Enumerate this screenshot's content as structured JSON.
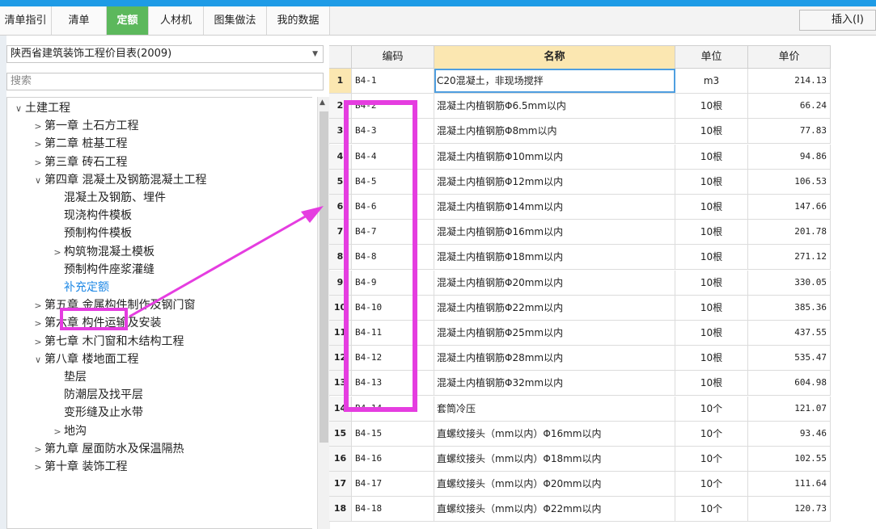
{
  "tabs": [
    {
      "label": "清单指引",
      "active": false
    },
    {
      "label": "清单",
      "active": false
    },
    {
      "label": "定额",
      "active": true
    },
    {
      "label": "人材机",
      "active": false
    },
    {
      "label": "图集做法",
      "active": false
    },
    {
      "label": "我的数据",
      "active": false
    }
  ],
  "insert_label": "插入(I)",
  "library": {
    "selected": "陕西省建筑装饰工程价目表(2009)"
  },
  "search": {
    "placeholder": "搜索"
  },
  "tree": [
    {
      "label": "土建工程",
      "level": 0,
      "toggle": "expanded"
    },
    {
      "label": "第一章 土石方工程",
      "level": 1,
      "toggle": "collapsed"
    },
    {
      "label": "第二章 桩基工程",
      "level": 1,
      "toggle": "collapsed"
    },
    {
      "label": "第三章 砖石工程",
      "level": 1,
      "toggle": "collapsed"
    },
    {
      "label": "第四章 混凝土及钢筋混凝土工程",
      "level": 1,
      "toggle": "expanded"
    },
    {
      "label": "混凝土及钢筋、埋件",
      "level": 2,
      "toggle": "none"
    },
    {
      "label": "现浇构件模板",
      "level": 2,
      "toggle": "none"
    },
    {
      "label": "预制构件模板",
      "level": 2,
      "toggle": "none"
    },
    {
      "label": "构筑物混凝土模板",
      "level": 2,
      "toggle": "collapsed"
    },
    {
      "label": "预制构件座浆灌缝",
      "level": 2,
      "toggle": "none"
    },
    {
      "label": "补充定额",
      "level": 2,
      "toggle": "none",
      "selected": true
    },
    {
      "label": "第五章 金属构件制作及钢门窗",
      "level": 1,
      "toggle": "collapsed"
    },
    {
      "label": "第六章 构件运输及安装",
      "level": 1,
      "toggle": "collapsed"
    },
    {
      "label": "第七章 木门窗和木结构工程",
      "level": 1,
      "toggle": "collapsed"
    },
    {
      "label": "第八章 楼地面工程",
      "level": 1,
      "toggle": "expanded"
    },
    {
      "label": "垫层",
      "level": 2,
      "toggle": "none"
    },
    {
      "label": "防潮层及找平层",
      "level": 2,
      "toggle": "none"
    },
    {
      "label": "变形缝及止水带",
      "level": 2,
      "toggle": "none"
    },
    {
      "label": "地沟",
      "level": 2,
      "toggle": "collapsed"
    },
    {
      "label": "第九章 屋面防水及保温隔热",
      "level": 1,
      "toggle": "collapsed"
    },
    {
      "label": "第十章 装饰工程",
      "level": 1,
      "toggle": "collapsed"
    }
  ],
  "table": {
    "headers": {
      "code": "编码",
      "name": "名称",
      "unit": "单位",
      "price": "单价"
    },
    "rows": [
      {
        "no": "1",
        "code": "B4-1",
        "name": "C20混凝土，非现场搅拌",
        "unit": "m3",
        "price": "214.13"
      },
      {
        "no": "2",
        "code": "B4-2",
        "name": "混凝土内植钢筋Φ6.5mm以内",
        "unit": "10根",
        "price": "66.24"
      },
      {
        "no": "3",
        "code": "B4-3",
        "name": "混凝土内植钢筋Φ8mm以内",
        "unit": "10根",
        "price": "77.83"
      },
      {
        "no": "4",
        "code": "B4-4",
        "name": "混凝土内植钢筋Φ10mm以内",
        "unit": "10根",
        "price": "94.86"
      },
      {
        "no": "5",
        "code": "B4-5",
        "name": "混凝土内植钢筋Φ12mm以内",
        "unit": "10根",
        "price": "106.53"
      },
      {
        "no": "6",
        "code": "B4-6",
        "name": "混凝土内植钢筋Φ14mm以内",
        "unit": "10根",
        "price": "147.66"
      },
      {
        "no": "7",
        "code": "B4-7",
        "name": "混凝土内植钢筋Φ16mm以内",
        "unit": "10根",
        "price": "201.78"
      },
      {
        "no": "8",
        "code": "B4-8",
        "name": "混凝土内植钢筋Φ18mm以内",
        "unit": "10根",
        "price": "271.12"
      },
      {
        "no": "9",
        "code": "B4-9",
        "name": "混凝土内植钢筋Φ20mm以内",
        "unit": "10根",
        "price": "330.05"
      },
      {
        "no": "10",
        "code": "B4-10",
        "name": "混凝土内植钢筋Φ22mm以内",
        "unit": "10根",
        "price": "385.36"
      },
      {
        "no": "11",
        "code": "B4-11",
        "name": "混凝土内植钢筋Φ25mm以内",
        "unit": "10根",
        "price": "437.55"
      },
      {
        "no": "12",
        "code": "B4-12",
        "name": "混凝土内植钢筋Φ28mm以内",
        "unit": "10根",
        "price": "535.47"
      },
      {
        "no": "13",
        "code": "B4-13",
        "name": "混凝土内植钢筋Φ32mm以内",
        "unit": "10根",
        "price": "604.98"
      },
      {
        "no": "14",
        "code": "B4-14",
        "name": "套筒冷压",
        "unit": "10个",
        "price": "121.07"
      },
      {
        "no": "15",
        "code": "B4-15",
        "name": "直螺纹接头（mm以内）Φ16mm以内",
        "unit": "10个",
        "price": "93.46"
      },
      {
        "no": "16",
        "code": "B4-16",
        "name": "直螺纹接头（mm以内）Φ18mm以内",
        "unit": "10个",
        "price": "102.55"
      },
      {
        "no": "17",
        "code": "B4-17",
        "name": "直螺纹接头（mm以内）Φ20mm以内",
        "unit": "10个",
        "price": "111.64"
      },
      {
        "no": "18",
        "code": "B4-18",
        "name": "直螺纹接头（mm以内）Φ22mm以内",
        "unit": "10个",
        "price": "120.73"
      }
    ]
  },
  "colors": {
    "accent": "#5cb85c",
    "highlight": "#e53de0",
    "header_name": "#fbe7b1",
    "selection": "#1e88e5"
  }
}
